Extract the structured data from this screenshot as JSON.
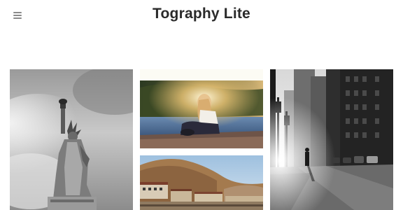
{
  "header": {
    "title": "Tography Lite",
    "menu_icon": "hamburger-menu-icon"
  },
  "colors": {
    "background": "#ffffff",
    "title": "#2a2a2a",
    "menu_icon": "#8a8a8a"
  },
  "gallery": {
    "items": [
      {
        "id": "statue",
        "subject": "statue-of-liberty-photo"
      },
      {
        "id": "girl",
        "subject": "girl-sunset-photo"
      },
      {
        "id": "town",
        "subject": "hillside-town-photo"
      },
      {
        "id": "street",
        "subject": "city-street-photo"
      }
    ]
  }
}
